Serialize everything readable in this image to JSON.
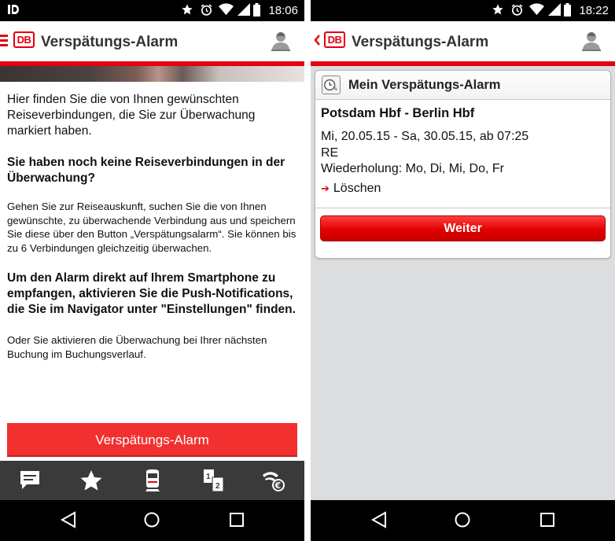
{
  "left_phone": {
    "status": {
      "time": "18:06",
      "notif_icon": "notification-app-icon"
    },
    "appbar": {
      "logo": "DB",
      "title": "Verspätungs-Alarm",
      "menu_icon": "hamburger-icon",
      "profile_icon": "user-profile-icon"
    },
    "intro": "Hier finden Sie die von Ihnen gewünschten Reiseverbindungen, die Sie zur Überwachung markiert haben.",
    "heading1": "Sie haben noch keine Reiseverbindungen in der Überwachung?",
    "para1": "Gehen Sie zur Reiseauskunft, suchen Sie die von Ihnen gewünschte, zu überwachende Verbindung aus und speichern Sie diese über den Button „Verspätungsalarm“. Sie können bis zu 6 Verbindungen gleichzeitig überwachen.",
    "heading2": "Um den Alarm direkt auf Ihrem Smartphone zu empfangen, aktivieren Sie die Push-Notifications, die Sie im Navigator unter \"Einstellungen\" finden.",
    "para2": "Oder Sie aktivieren die Überwachung bei Ihrer nächsten Buchung im Buchungsverlauf.",
    "button_label": "Verspätungs-Alarm",
    "bottom_nav": [
      "chat-icon",
      "star-icon",
      "train-icon",
      "seat-reservation-icon",
      "ticket-euro-icon"
    ]
  },
  "right_phone": {
    "status": {
      "time": "18:22"
    },
    "appbar": {
      "logo": "DB",
      "title": "Verspätungs-Alarm",
      "back_icon": "back-chevron-icon",
      "profile_icon": "user-profile-icon"
    },
    "card": {
      "title": "Mein Verspätungs-Alarm",
      "route": "Potsdam Hbf - Berlin Hbf",
      "dates": "Mi, 20.05.15 - Sa, 30.05.15, ab 07:25",
      "train": "RE",
      "repeat": "Wiederholung: Mo, Di, Mi, Do, Fr",
      "delete_label": "Löschen",
      "button_label": "Weiter"
    }
  },
  "colors": {
    "db_red": "#e3000f",
    "button_red": "#f23030",
    "nav_bg": "#3a3a3a",
    "right_bg": "#dcdddf"
  }
}
